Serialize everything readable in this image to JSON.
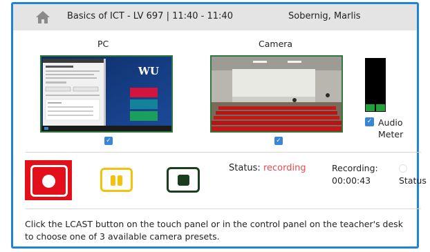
{
  "header": {
    "course": "Basics of ICT - LV 697 | 11:40 - 11:40",
    "user": "Sobernig, Marlis",
    "home_icon": "home-icon"
  },
  "sources": {
    "pc_label": "PC",
    "camera_label": "Camera",
    "pc_selected": true,
    "camera_selected": true
  },
  "audio": {
    "label_line1": "Audio",
    "label_line2": "Meter",
    "enabled": true
  },
  "controls": {
    "record_icon": "record-icon",
    "pause_icon": "pause-icon",
    "stop_icon": "stop-icon"
  },
  "status": {
    "label": "Status:",
    "value": "recording",
    "recording_label": "Recording:",
    "recording_time": "00:00:43",
    "status_word": "Status"
  },
  "info_text": "Click the LCAST button on the touch panel or in the control panel on the teacher's desk to choose one of 3 available camera presets.",
  "colors": {
    "frame": "#1f83d6",
    "record": "#e3101a",
    "pause": "#f3c20c",
    "stop": "#1b3d1f",
    "recording_text": "#e84a4a",
    "meter_level": "#1fa339"
  }
}
